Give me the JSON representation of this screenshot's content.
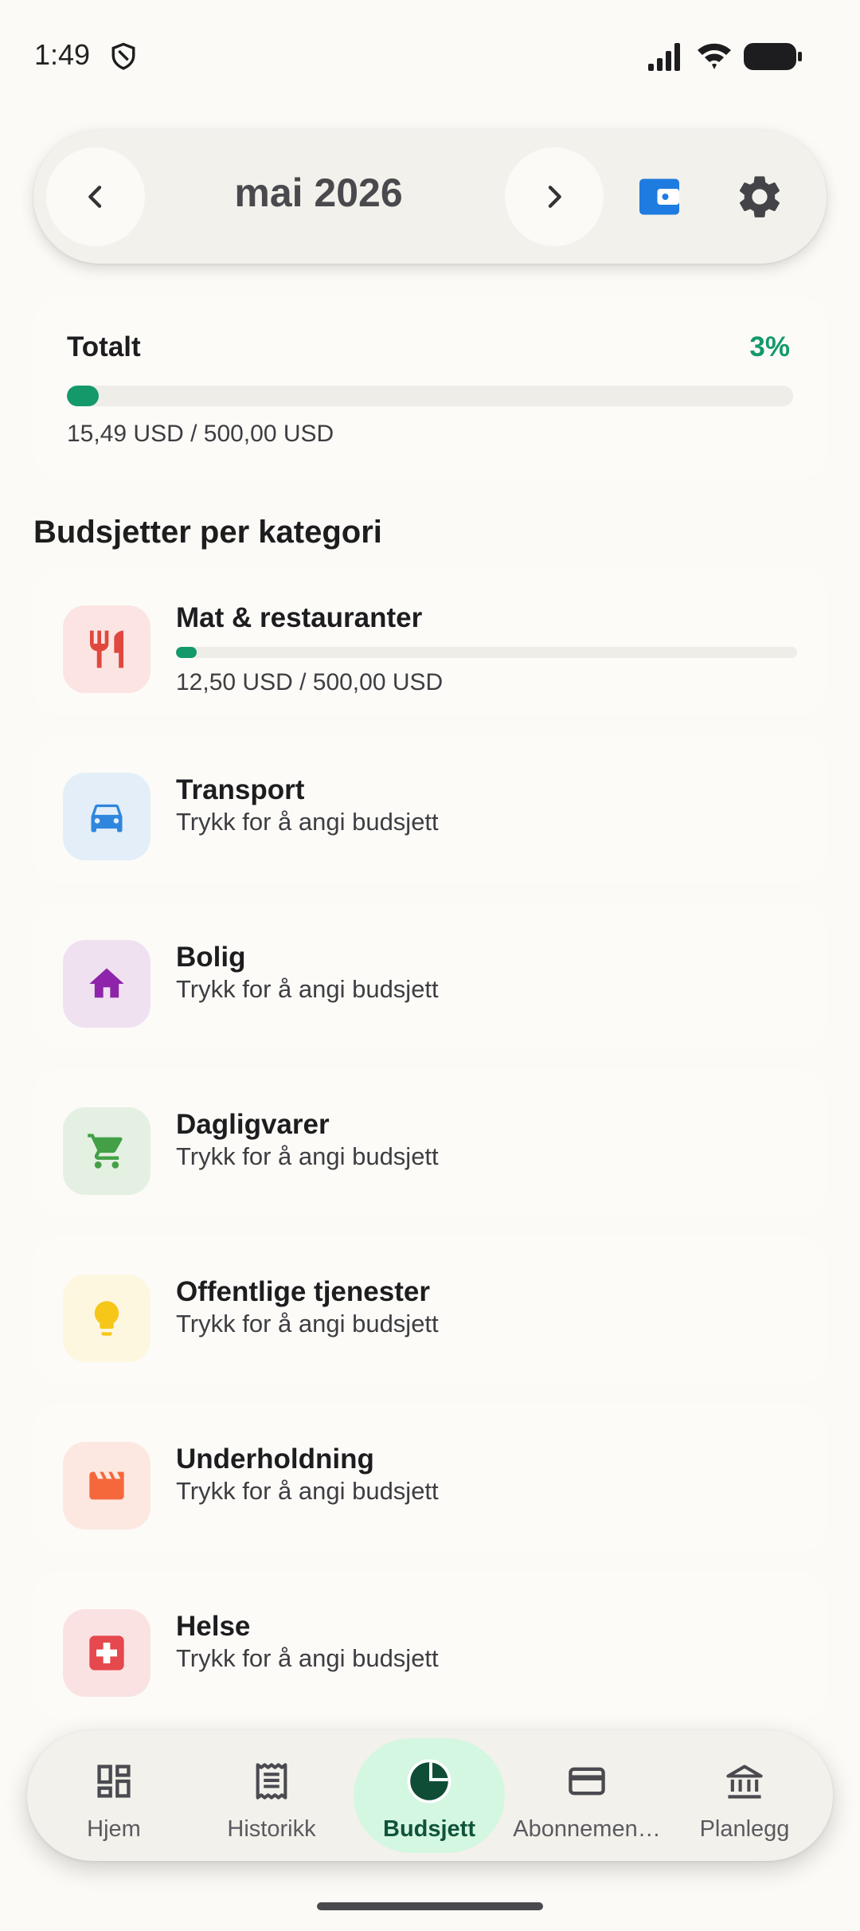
{
  "status_bar": {
    "time": "1:49"
  },
  "header": {
    "month": "mai 2026"
  },
  "total": {
    "title": "Totalt",
    "percent": "3%",
    "progress": 0.031,
    "amount": "15,49 USD / 500,00 USD"
  },
  "section_title": "Budsjetter per kategori",
  "categories": [
    {
      "name": "Mat & restauranter",
      "amount": "12,50 USD / 500,00 USD",
      "progress": 0.025,
      "icon": "restaurant-icon",
      "bg": "#FBE4E2",
      "color": "#E0483E"
    },
    {
      "name": "Transport",
      "subtitle": "Trykk for å angi budsjett",
      "icon": "car-icon",
      "bg": "#E3EEF8",
      "color": "#2F86DD"
    },
    {
      "name": "Bolig",
      "subtitle": "Trykk for å angi budsjett",
      "icon": "home-icon",
      "bg": "#F0E1F1",
      "color": "#8E24AA"
    },
    {
      "name": "Dagligvarer",
      "subtitle": "Trykk for å angi budsjett",
      "icon": "cart-icon",
      "bg": "#E4F0E2",
      "color": "#43A047"
    },
    {
      "name": "Offentlige tjenester",
      "subtitle": "Trykk for å angi budsjett",
      "icon": "lightbulb-icon",
      "bg": "#FDF7DF",
      "color": "#F6C619"
    },
    {
      "name": "Underholdning",
      "subtitle": "Trykk for å angi budsjett",
      "icon": "clapperboard-icon",
      "bg": "#FCE8E1",
      "color": "#F4683C"
    },
    {
      "name": "Helse",
      "subtitle": "Trykk for å angi budsjett",
      "icon": "medical-cross-icon",
      "bg": "#FBE2E2",
      "color": "#E5484D"
    }
  ],
  "nav": {
    "items": [
      {
        "label": "Hjem",
        "icon": "dashboard-icon"
      },
      {
        "label": "Historikk",
        "icon": "receipt-icon"
      },
      {
        "label": "Budsjett",
        "icon": "pie-chart-icon",
        "active": true
      },
      {
        "label": "Abonnemen…",
        "icon": "credit-card-icon"
      },
      {
        "label": "Planlegg",
        "icon": "bank-icon"
      }
    ]
  },
  "colors": {
    "accent": "#14996B",
    "active_nav_bg": "#D4F7E1",
    "wallet": "#1E7BE0"
  }
}
